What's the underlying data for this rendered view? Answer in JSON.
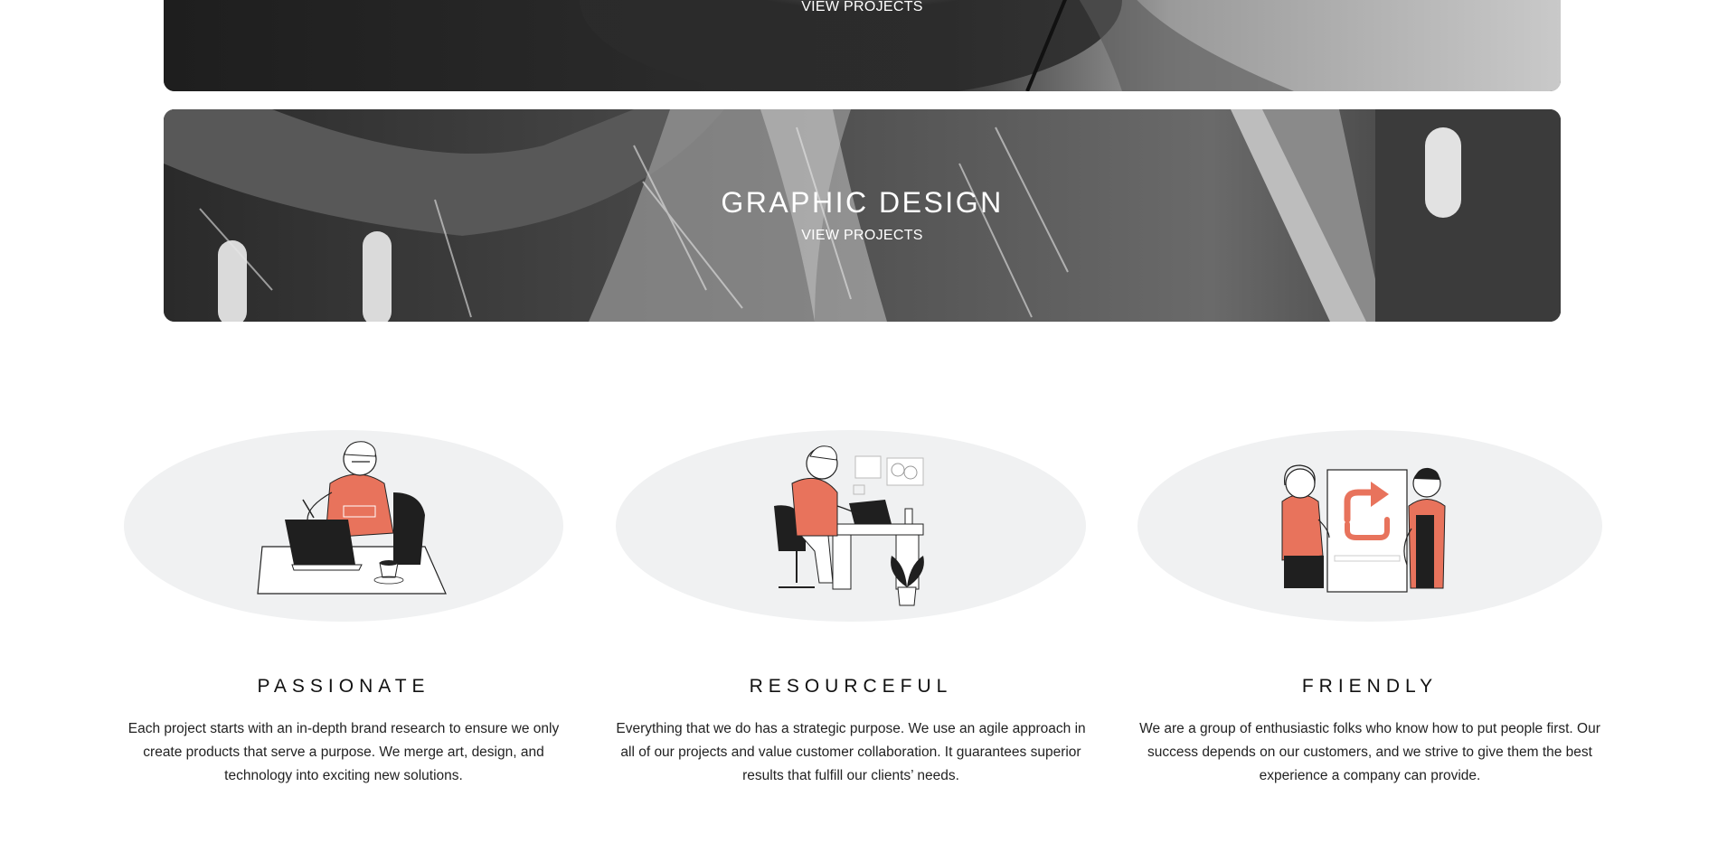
{
  "categories": [
    {
      "title": "",
      "link_label": "VIEW PROJECTS"
    },
    {
      "title": "GRAPHIC DESIGN",
      "link_label": "VIEW PROJECTS"
    }
  ],
  "features": [
    {
      "title": "PASSIONATE",
      "text": "Each project starts with an in-depth brand research to ensure we only create products that serve a purpose. We merge art, design, and technology into exciting new solutions.",
      "illustration": "person-laptop-illustration"
    },
    {
      "title": "RESOURCEFUL",
      "text": "Everything that we do has a strategic purpose. We use an agile approach in all of our projects and value customer collaboration. It guarantees superior results that fulfill our clients’ needs.",
      "illustration": "person-drawing-tablet-illustration"
    },
    {
      "title": "FRIENDLY",
      "text": "We are a group of enthusiastic folks who know how to put people first. Our success depends on our customers, and we strive to give them the best experience a company can provide.",
      "illustration": "people-sharing-board-illustration"
    }
  ],
  "colors": {
    "accent": "#e8735c",
    "ellipse": "#f0f1f2",
    "dark": "#1f1f1f"
  }
}
